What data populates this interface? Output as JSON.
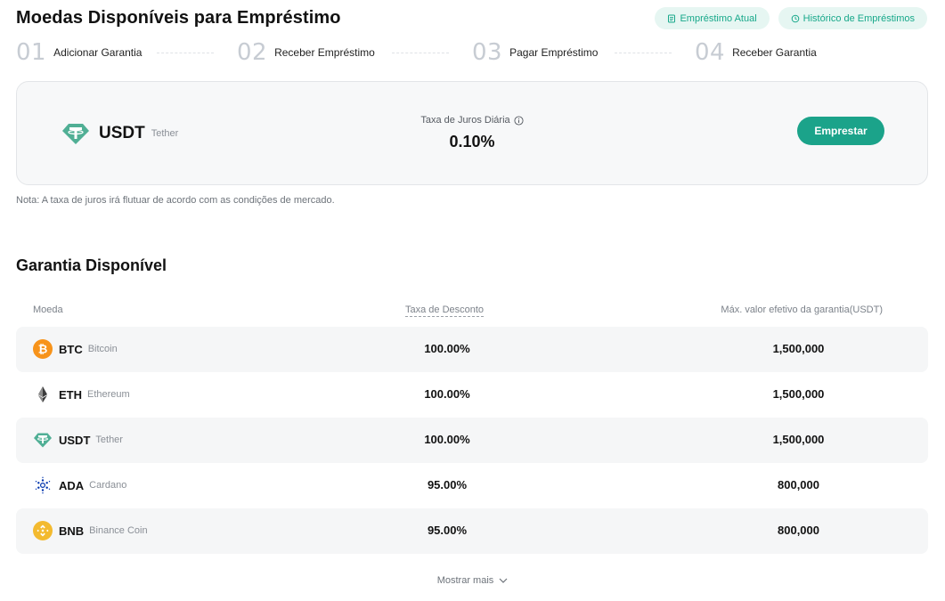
{
  "page_title": "Moedas Disponíveis para Empréstimo",
  "top_actions": {
    "current_loan": "Empréstimo Atual",
    "loan_history": "Histórico de Empréstimos"
  },
  "steps": [
    {
      "num": "01",
      "label": "Adicionar Garantia"
    },
    {
      "num": "02",
      "label": "Receber Empréstimo"
    },
    {
      "num": "03",
      "label": "Pagar Empréstimo"
    },
    {
      "num": "04",
      "label": "Receber Garantia"
    }
  ],
  "loan_card": {
    "symbol": "USDT",
    "name": "Tether",
    "rate_label": "Taxa de Juros Diária",
    "rate_value": "0.10%",
    "borrow_label": "Emprestar"
  },
  "note": "Nota: A taxa de juros irá flutuar de acordo com as condições de mercado.",
  "collateral": {
    "title": "Garantia Disponível",
    "columns": {
      "coin": "Moeda",
      "discount": "Taxa de Desconto",
      "max": "Máx. valor efetivo da garantia(USDT)"
    },
    "rows": [
      {
        "symbol": "BTC",
        "name": "Bitcoin",
        "discount": "100.00%",
        "max": "1,500,000",
        "icon": "bitcoin-icon"
      },
      {
        "symbol": "ETH",
        "name": "Ethereum",
        "discount": "100.00%",
        "max": "1,500,000",
        "icon": "ethereum-icon"
      },
      {
        "symbol": "USDT",
        "name": "Tether",
        "discount": "100.00%",
        "max": "1,500,000",
        "icon": "tether-icon"
      },
      {
        "symbol": "ADA",
        "name": "Cardano",
        "discount": "95.00%",
        "max": "800,000",
        "icon": "cardano-icon"
      },
      {
        "symbol": "BNB",
        "name": "Binance Coin",
        "discount": "95.00%",
        "max": "800,000",
        "icon": "binance-coin-icon"
      }
    ],
    "show_more": "Mostrar mais"
  },
  "colors": {
    "accent": "#1ba38a",
    "pill_bg": "#e6f6f2",
    "pill_text": "#17a88a",
    "bitcoin": "#f7931a",
    "tether": "#50af95",
    "cardano": "#0033ad",
    "binance": "#f3ba2f"
  }
}
